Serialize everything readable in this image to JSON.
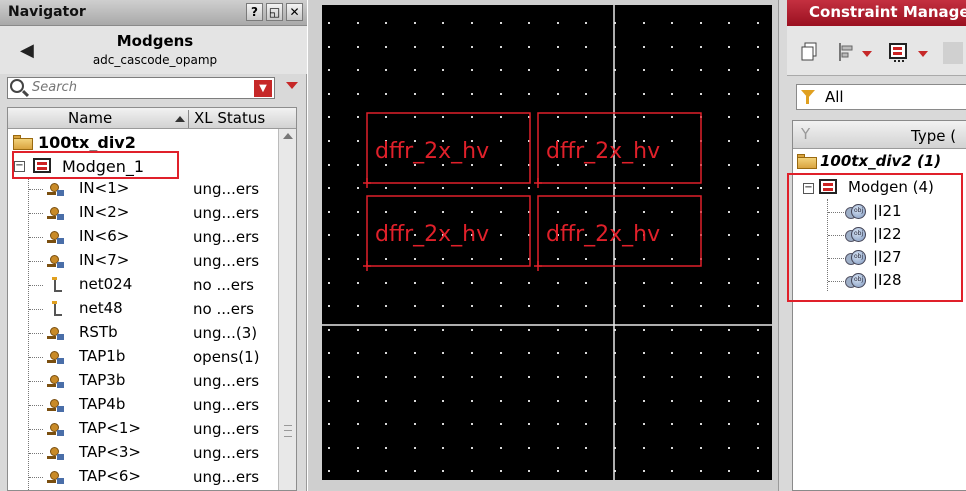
{
  "navigator": {
    "title": "Navigator",
    "title_buttons": [
      "?",
      "◱",
      "✕"
    ],
    "back_icon": "◀",
    "header_name": "Modgens",
    "header_sub": "adc_cascode_opamp",
    "search_placeholder": "Search",
    "columns": {
      "name": "Name",
      "xl_status": "XL Status"
    },
    "root": "100tx_div2",
    "modgen": "Modgen_1",
    "rows": [
      {
        "name": "IN<1>",
        "status": "ung...ers",
        "icon": "pin-icon"
      },
      {
        "name": "IN<2>",
        "status": "ung...ers",
        "icon": "pin-icon"
      },
      {
        "name": "IN<6>",
        "status": "ung...ers",
        "icon": "pin-icon"
      },
      {
        "name": "IN<7>",
        "status": "ung...ers",
        "icon": "pin-icon"
      },
      {
        "name": "net024",
        "status": "no ...ers",
        "icon": "net-icon"
      },
      {
        "name": "net48",
        "status": "no ...ers",
        "icon": "net-icon"
      },
      {
        "name": "RSTb",
        "status": "ung...(3)",
        "icon": "pin-icon"
      },
      {
        "name": "TAP1b",
        "status": "opens(1)",
        "icon": "pin-icon"
      },
      {
        "name": "TAP3b",
        "status": "ung...ers",
        "icon": "pin-icon"
      },
      {
        "name": "TAP4b",
        "status": "ung...ers",
        "icon": "pin-icon"
      },
      {
        "name": "TAP<1>",
        "status": "ung...ers",
        "icon": "pin-icon"
      },
      {
        "name": "TAP<3>",
        "status": "ung...ers",
        "icon": "pin-icon"
      },
      {
        "name": "TAP<6>",
        "status": "ung...ers",
        "icon": "pin-icon"
      }
    ]
  },
  "canvas": {
    "instances": [
      "dffr_2x_hv",
      "dffr_2x_hv",
      "dffr_2x_hv",
      "dffr_2x_hv"
    ]
  },
  "constraint_manager": {
    "title": "Constraint Manage",
    "filter": "All",
    "column_type": "Type (",
    "root": "100tx_div2 (1)",
    "modgen": "Modgen (4)",
    "members": [
      "|I21",
      "|I22",
      "|I27",
      "|I28"
    ]
  },
  "colors": {
    "highlight_red": "#e0202a",
    "canvas_bg": "#000000",
    "cm_title_bg": "#b01c2c"
  }
}
